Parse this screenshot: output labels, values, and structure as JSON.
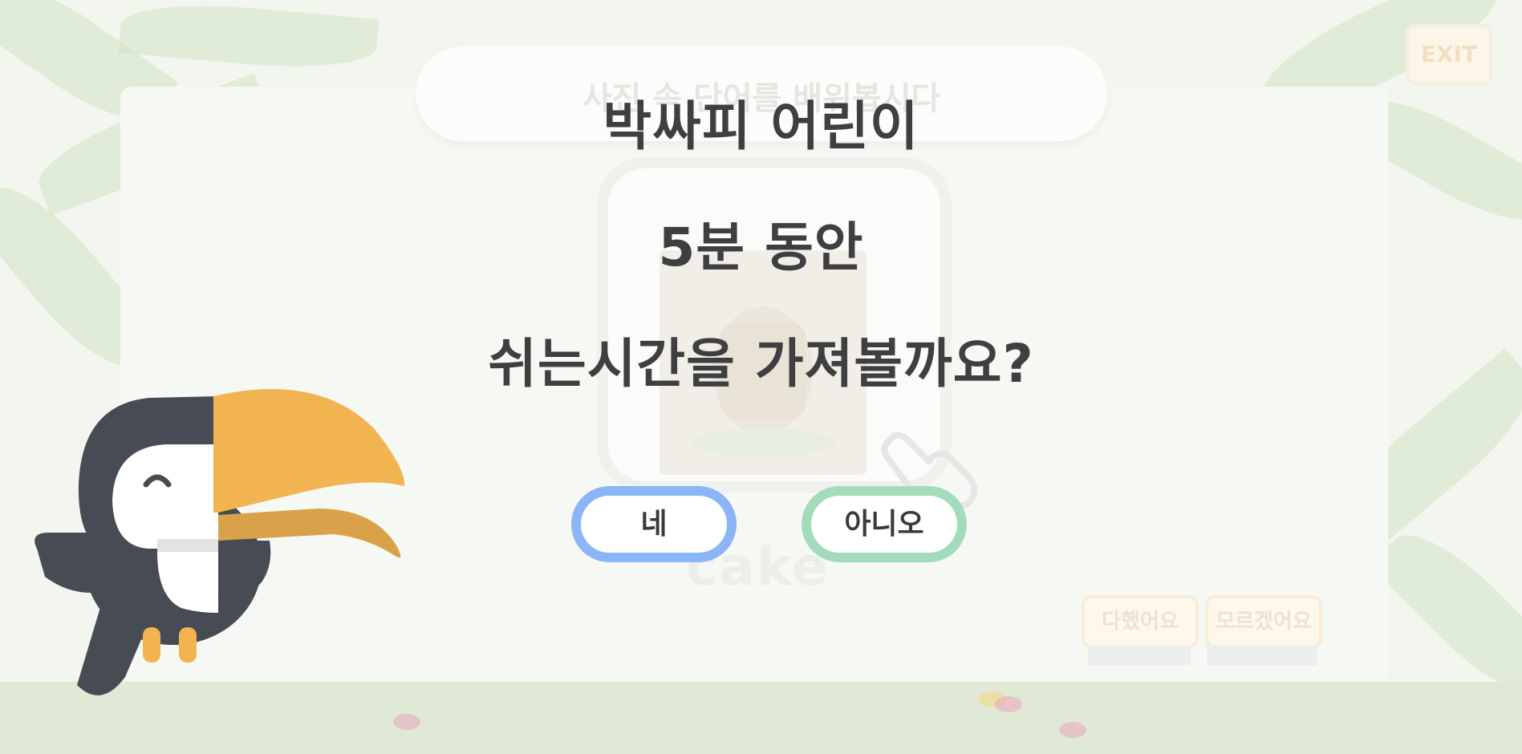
{
  "background": {
    "quiz_title": "사진 속 단어를 배워봅시다",
    "quiz_word": "cake",
    "exit_label": "EXIT",
    "done_label": "다했어요",
    "dont_know_label": "모르겠어요"
  },
  "dialog": {
    "line1": "박싸피 어린이",
    "line2": "5분 동안",
    "line3": "쉬는시간을 가져볼까요?",
    "yes_label": "네",
    "no_label": "아니오"
  },
  "colors": {
    "yes_border": "#8ab6f7",
    "no_border": "#a2dcbc",
    "text": "#3f3f41",
    "toucan_beak": "#f2b451",
    "toucan_body": "#474b53"
  },
  "icons": {
    "mascot": "toucan-mascot",
    "hint": "pointing-hand-icon"
  }
}
